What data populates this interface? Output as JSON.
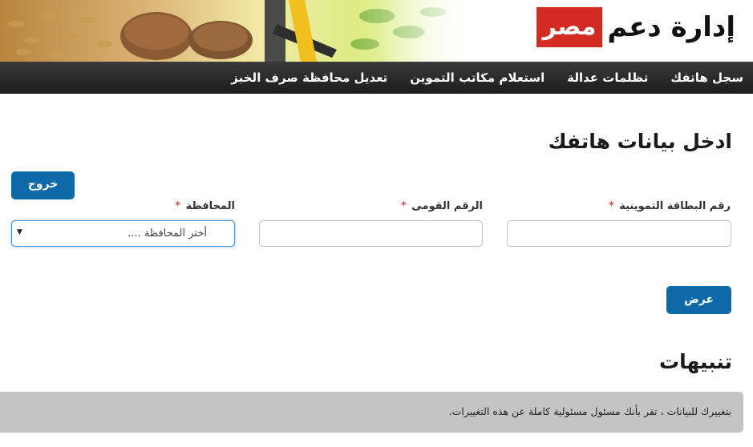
{
  "header": {
    "logo_text": "إدارة دعم",
    "logo_badge": "مصر"
  },
  "nav": {
    "items": [
      {
        "label": "سجل هاتفك"
      },
      {
        "label": "تظلمات عدالة"
      },
      {
        "label": "استعلام مكاتب التموين"
      },
      {
        "label": "تعديل محافظة صرف الخبز"
      }
    ]
  },
  "form": {
    "title": "ادخل بيانات هاتفك",
    "logout_label": "خروج",
    "card_label": "رقم البطاقة التموينية",
    "national_label": "الرقم القومى",
    "gov_label": "المحافظة",
    "required_mark": "*",
    "gov_select_value": "أختر المحافظة ....",
    "submit_label": "عرض"
  },
  "alerts": {
    "title": "تنبيهات",
    "text": "بتغييرك للبيانات ، تقر بأنك مسئول مسئولية كاملة عن هذه التغييرات."
  },
  "colors": {
    "primary_button": "#0e69a8",
    "logo_red": "#d42a24",
    "nav_bg": "#2a2a2a",
    "required": "#d9534f",
    "notice_bg": "#c4c4c4"
  }
}
